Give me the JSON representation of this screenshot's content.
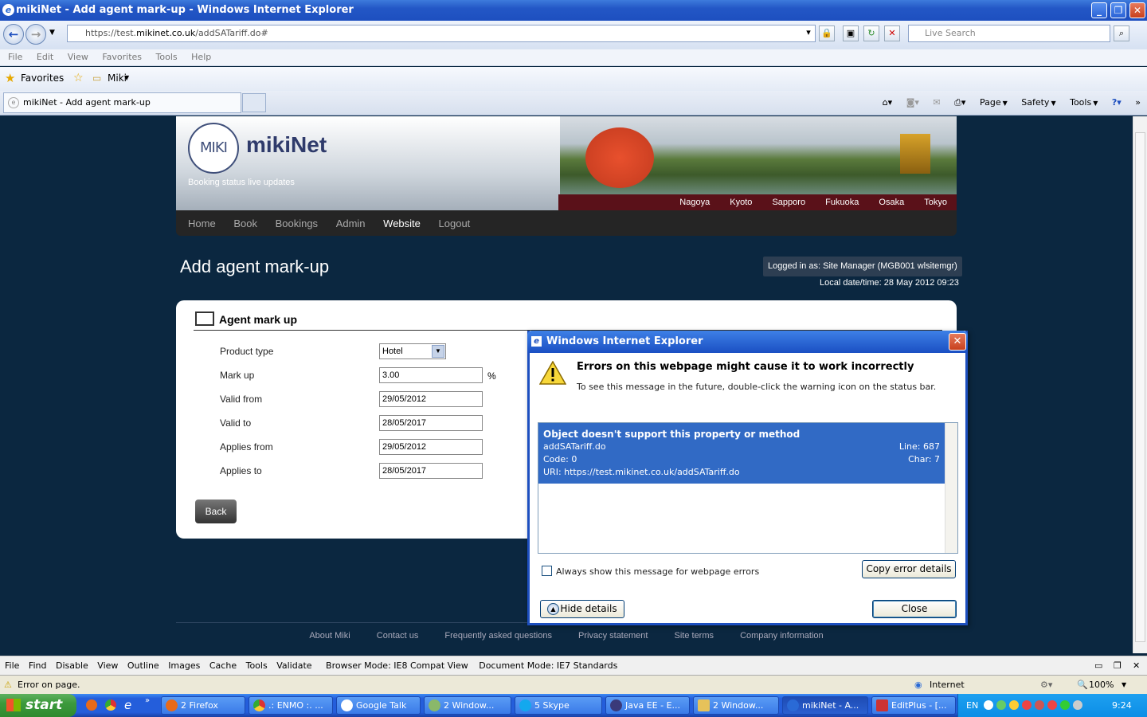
{
  "window": {
    "title": "mikiNet - Add agent mark-up - Windows Internet Explorer"
  },
  "address": {
    "prefix": "https://test.",
    "domain": "mikinet.co.uk",
    "path": "/addSATariff.do#"
  },
  "search": {
    "placeholder": "Live Search"
  },
  "menu": [
    "File",
    "Edit",
    "View",
    "Favorites",
    "Tools",
    "Help"
  ],
  "favorites": {
    "label": "Favorites",
    "folder": "Miki"
  },
  "tab": {
    "title": "mikiNet - Add agent mark-up"
  },
  "commands": [
    "Page",
    "Safety",
    "Tools"
  ],
  "site": {
    "brand": "mikiNet",
    "logo_text": "MIKI",
    "tagline": "Booking status live updates",
    "cities": [
      "Nagoya",
      "Kyoto",
      "Sapporo",
      "Fukuoka",
      "Osaka",
      "Tokyo"
    ],
    "nav": [
      "Home",
      "Book",
      "Bookings",
      "Admin",
      "Website",
      "Logout"
    ],
    "page_title": "Add agent mark-up",
    "logged_in": "Logged in as: Site Manager (MGB001 wlsitemgr)",
    "local_datetime": "Local date/time: 28 May 2012 09:23",
    "card_title": "Agent mark up",
    "fields": [
      {
        "label": "Product type",
        "value": "Hotel"
      },
      {
        "label": "Mark up",
        "value": "3.00"
      },
      {
        "label": "Valid from",
        "value": "29/05/2012"
      },
      {
        "label": "Valid to",
        "value": "28/05/2017"
      },
      {
        "label": "Applies from",
        "value": "29/05/2012"
      },
      {
        "label": "Applies to",
        "value": "28/05/2017"
      }
    ],
    "percent": "%",
    "back": "Back",
    "footer": [
      "About Miki",
      "Contact us",
      "Frequently asked questions",
      "Privacy statement",
      "Site terms",
      "Company information"
    ]
  },
  "dialog": {
    "title": "Windows Internet Explorer",
    "heading": "Errors on this webpage might cause it to work incorrectly",
    "sub": "To see this message in the future, double-click the warning icon on the status bar.",
    "error": {
      "message": "Object doesn't support this property or method",
      "file": "addSATariff.do",
      "line": "Line: 687",
      "code": "Code: 0",
      "char": "Char: 7",
      "uri": "URI: https://test.mikinet.co.uk/addSATariff.do"
    },
    "checkbox": "Always show this message for webpage errors",
    "copy": "Copy error details",
    "hide": "Hide details",
    "close": "Close"
  },
  "devtools": {
    "items": [
      "File",
      "Find",
      "Disable",
      "View",
      "Outline",
      "Images",
      "Cache",
      "Tools",
      "Validate"
    ],
    "browser_mode": "Browser Mode: IE8 Compat View",
    "document_mode": "Document Mode: IE7 Standards"
  },
  "status": {
    "text": "Error on page.",
    "zone": "Internet",
    "zoom": "100%"
  },
  "taskbar": {
    "start": "start",
    "tasks": [
      "2 Firefox",
      ".: ENMO :. ...",
      "Google Talk",
      "2 Window...",
      "5 Skype",
      "Java EE - E...",
      "2 Window...",
      "mikiNet - A...",
      "EditPlus - [..."
    ],
    "lang": "EN",
    "time": "9:24 AM"
  }
}
